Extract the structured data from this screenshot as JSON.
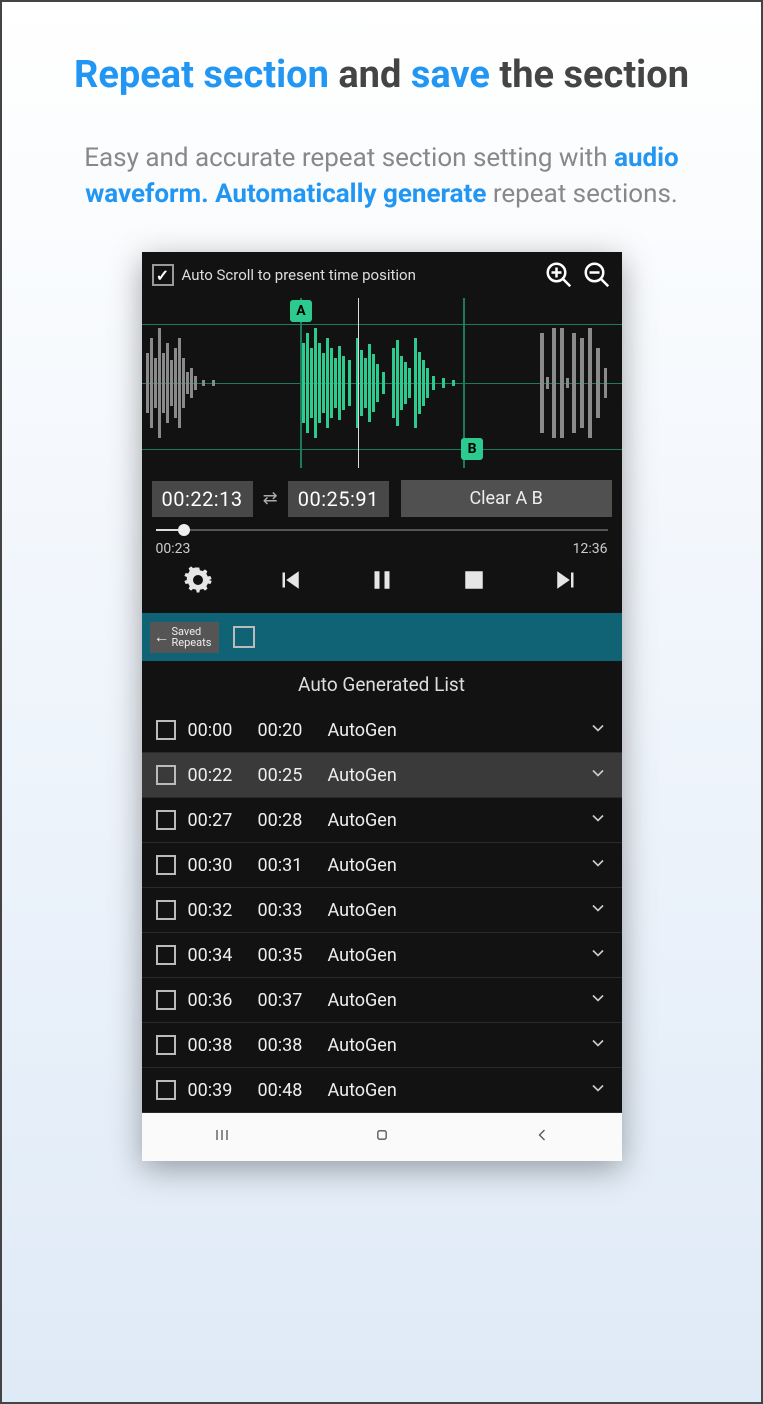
{
  "promo": {
    "t1": "Repeat section",
    "t2": " and ",
    "t3": "save",
    "t4": " the section",
    "s1": "Easy and accurate repeat section setting with ",
    "s2": "audio waveform. Automatically generate",
    "s3": " repeat sections."
  },
  "topbar": {
    "autoscroll_checked": true,
    "autoscroll_label": "Auto Scroll to present time position"
  },
  "markers": {
    "a": "A",
    "b": "B"
  },
  "ab": {
    "time_a": "00:22:13",
    "time_b": "00:25:91",
    "clear": "Clear A B"
  },
  "seek": {
    "elapsed": "00:23",
    "total": "12:36"
  },
  "saved_repeats_label": "Saved\nRepeats",
  "list_header": "Auto Generated List",
  "rows": [
    {
      "start": "00:00",
      "end": "00:20",
      "label": "AutoGen",
      "selected": false
    },
    {
      "start": "00:22",
      "end": "00:25",
      "label": "AutoGen",
      "selected": true
    },
    {
      "start": "00:27",
      "end": "00:28",
      "label": "AutoGen",
      "selected": false
    },
    {
      "start": "00:30",
      "end": "00:31",
      "label": "AutoGen",
      "selected": false
    },
    {
      "start": "00:32",
      "end": "00:33",
      "label": "AutoGen",
      "selected": false
    },
    {
      "start": "00:34",
      "end": "00:35",
      "label": "AutoGen",
      "selected": false
    },
    {
      "start": "00:36",
      "end": "00:37",
      "label": "AutoGen",
      "selected": false
    },
    {
      "start": "00:38",
      "end": "00:38",
      "label": "AutoGen",
      "selected": false
    },
    {
      "start": "00:39",
      "end": "00:48",
      "label": "AutoGen",
      "selected": false
    }
  ]
}
